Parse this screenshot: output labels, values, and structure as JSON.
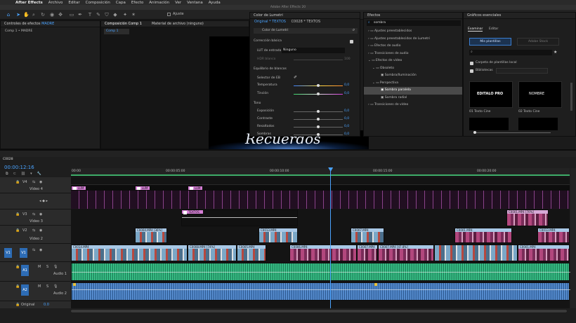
{
  "menubar": {
    "app": "After Effects",
    "items": [
      "Archivo",
      "Editar",
      "Composición",
      "Capa",
      "Efecto",
      "Animación",
      "Ver",
      "Ventana",
      "Ayuda"
    ],
    "window_title": "Adobe After Effects 20"
  },
  "toolbar": {
    "snap_label": "Ajuste"
  },
  "project_panel": {
    "title_prefix": "Controles de efectos",
    "title_target": "MADRE",
    "breadcrumb": "Comp 1 • MADRE"
  },
  "comp_panel": {
    "tab_label": "Composición Comp 1",
    "subtab": "Comp 1",
    "footage_tab": "Material de archivo (ninguno)",
    "preview_text": "Recuerdos"
  },
  "lumetri": {
    "title": "Color de Lumetri",
    "source": "Original * TEXTOS",
    "target": "C0028 * TEXTOS",
    "fx_name": "Color de Lumetri",
    "basic": "Corrección básica",
    "lut_label": "LUT de entrada",
    "lut_value": "Ninguno",
    "hdr_label": "HDR blanco",
    "hdr_value": "100",
    "wb_section": "Equilibrio de blancos",
    "wb_selector": "Selector de EB",
    "temp_label": "Temperatura",
    "temp_value": "0,0",
    "tint_label": "Tinción",
    "tint_value": "0,0",
    "tone_section": "Tono",
    "exposure_label": "Exposición",
    "exposure_value": "0,0",
    "contrast_label": "Contraste",
    "contrast_value": "0,0",
    "highlights_label": "Resaltados",
    "highlights_value": "0,0",
    "shadows_label": "Sombras",
    "shadows_value": "0,0"
  },
  "effects": {
    "title": "Efectos",
    "search_value": "sombra",
    "items": [
      {
        "label": "Ajustes preestablecidos",
        "indent": 0
      },
      {
        "label": "Ajustes preestablecidos de Lumetri",
        "indent": 0
      },
      {
        "label": "Efectos de audio",
        "indent": 0
      },
      {
        "label": "Transiciones de audio",
        "indent": 0
      },
      {
        "label": "Efectos de vídeo",
        "indent": 0
      },
      {
        "label": "Obsoleto",
        "indent": 1
      },
      {
        "label": "Sombra/Iluminación",
        "indent": 2
      },
      {
        "label": "Perspectiva",
        "indent": 1
      },
      {
        "label": "Sombra paralela",
        "indent": 2
      },
      {
        "label": "Sombra radial",
        "indent": 2
      },
      {
        "label": "Transiciones de vídeo",
        "indent": 0
      }
    ]
  },
  "graphics": {
    "title": "Gráficos esenciales",
    "tab_browse": "Examinar",
    "tab_edit": "Editar",
    "my_templates": "Mis plantillas",
    "adobe_stock": "Adobe Stock",
    "local_folder": "Carpeta de plantillas local",
    "libraries": "Bibliotecas",
    "template1": "01 Texto Cine",
    "template2": "02 Texto Cine",
    "template1_art": "EDITALO PRO",
    "template2_art": "NOMBRE"
  },
  "timeline": {
    "sequence": "C0028",
    "timecode": "00:00:12:16",
    "ruler": [
      "00:00",
      "00:00:05:00",
      "00:00:10:00",
      "00:00:15:00",
      "00:00:20:00"
    ],
    "playhead_fraction": 0.52,
    "tracks": [
      {
        "id": "V4",
        "name": "Vídeo 4"
      },
      {
        "id": "V3",
        "name": "Vídeo 3"
      },
      {
        "id": "V2",
        "name": "Vídeo 2"
      },
      {
        "id": "V1",
        "name": ""
      },
      {
        "id": "A1",
        "name": "Audio 1"
      },
      {
        "id": "A2",
        "name": "Audio 2"
      }
    ],
    "track_flags": [
      "M",
      "S"
    ],
    "source_tag": "V1",
    "clips_v4": [
      "LUM",
      "LUM",
      "LUM"
    ],
    "clip_v3": "TEXTOS",
    "clips_v2": [
      "C0004.MP4 [36%]",
      "C0013.MP4",
      "C0007.MP4",
      "C0001.MP4",
      "C0013.MP4"
    ],
    "clips_v1": [
      "C0014.MP4",
      "C0008.MP4 [74%]",
      "C0005.MP4",
      "C0006.MP4",
      "C0007.MP4",
      "C0007.MP4 [47.8%]",
      "C0001.MP4"
    ],
    "clip_v4b": "C0001.MP4 [70%]",
    "original_label": "Original",
    "original_value": "0.0"
  }
}
